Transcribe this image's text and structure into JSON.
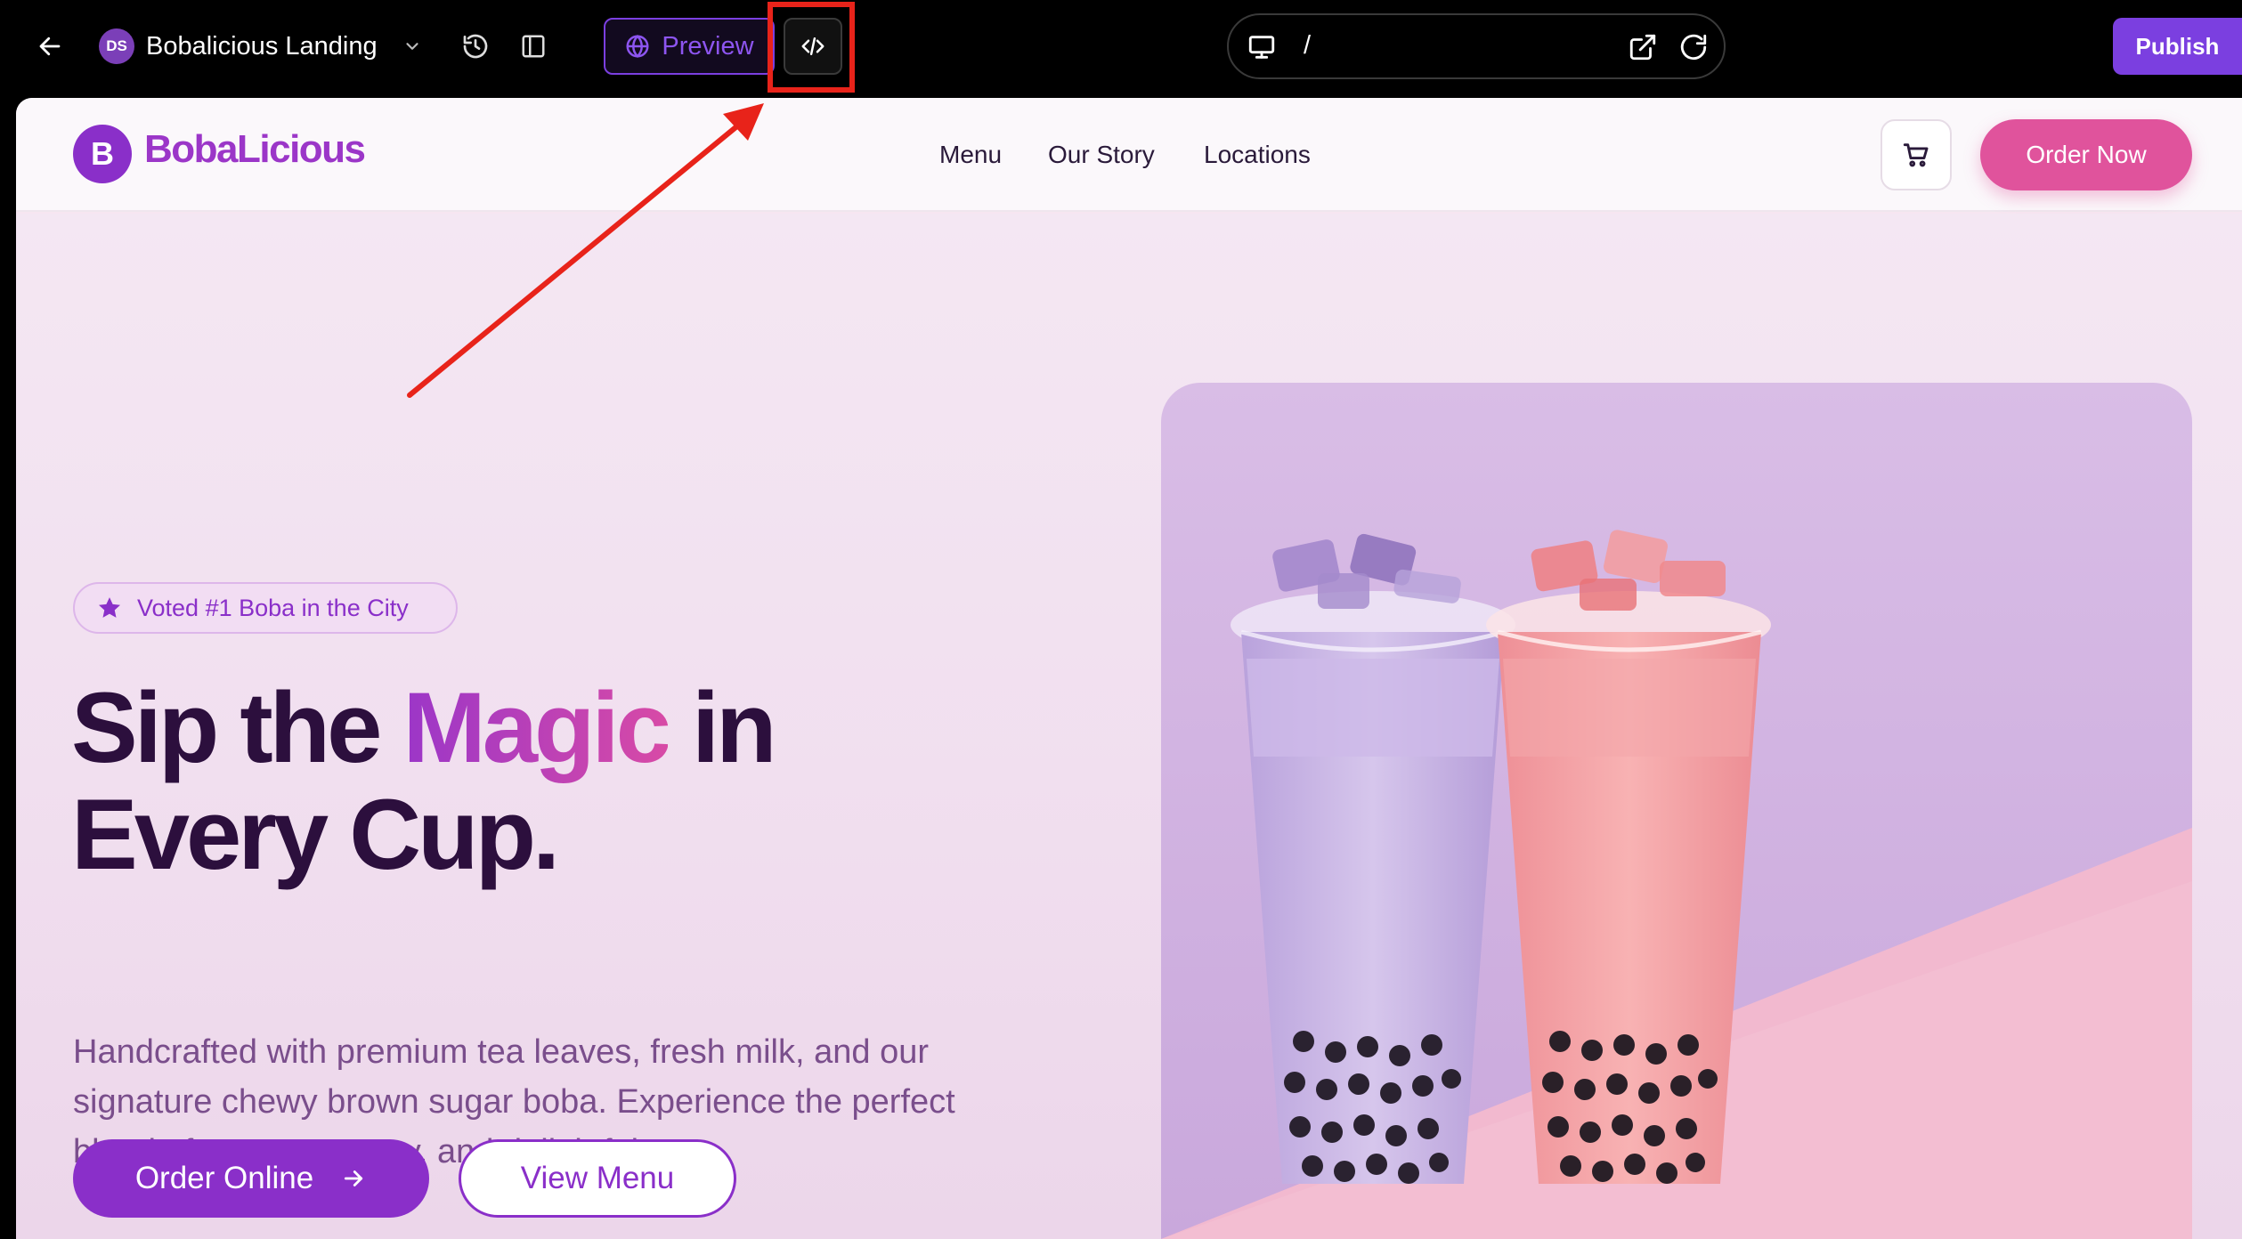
{
  "editor": {
    "avatar_initials": "DS",
    "project_name": "Bobalicious Landing",
    "preview_label": "Preview",
    "url_path": "/",
    "publish_label": "Publish",
    "icons": [
      "back-arrow-icon",
      "chevron-down-icon",
      "history-icon",
      "panel-icon",
      "globe-icon",
      "code-icon",
      "desktop-icon",
      "external-link-icon",
      "refresh-icon"
    ]
  },
  "site": {
    "logo_letter": "B",
    "logo_text": "BobaLicious",
    "nav": [
      "Menu",
      "Our Story",
      "Locations"
    ],
    "order_now": "Order Now",
    "badge": "Voted #1 Boba in the City",
    "title_line1_a": "Sip the ",
    "title_magic": "Magic",
    "title_line1_b": " in",
    "title_line2": "Every Cup.",
    "subtitle": "Handcrafted with premium tea leaves, fresh milk, and our signature chewy brown sugar boba. Experience the perfect blend of sweet, creamy, and delightful.",
    "order_online": "Order Online",
    "view_menu": "View Menu",
    "hero_image": "two iced boba milk tea cups, purple taro and pink strawberry"
  },
  "colors": {
    "editor_bg": "#000000",
    "editor_accent": "#7b3fe0",
    "brand_purple": "#8a2fc9",
    "brand_pink": "#e0539c",
    "title_dark": "#2c0f3d",
    "annotation_red": "#e8231a"
  }
}
